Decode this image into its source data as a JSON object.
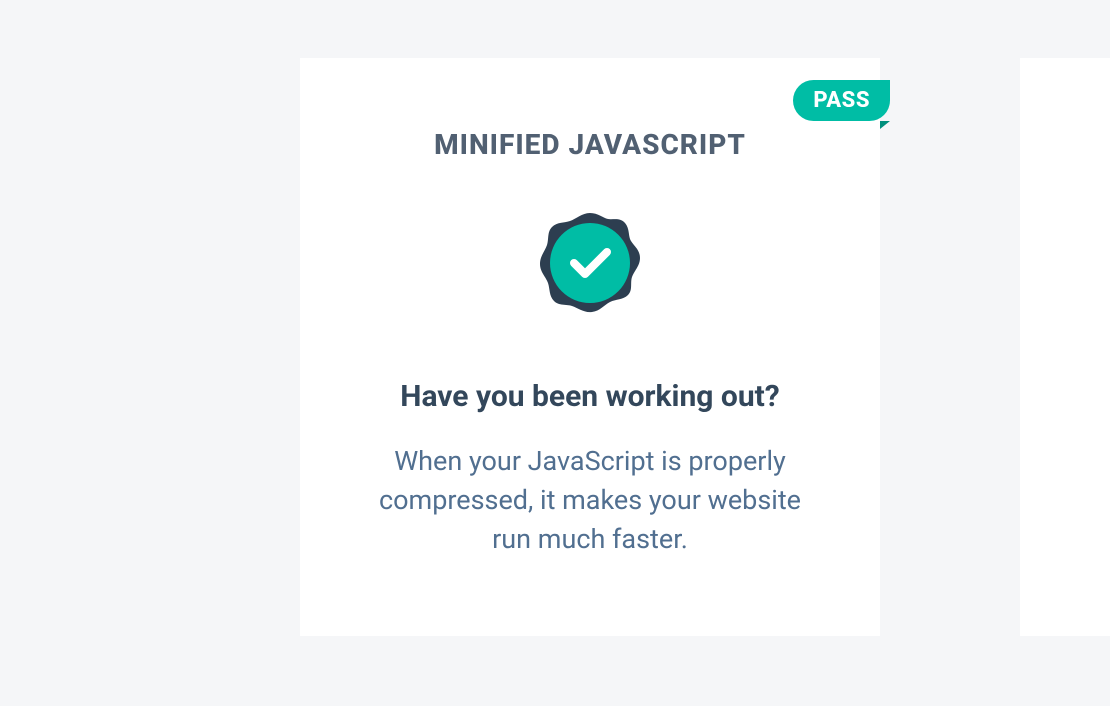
{
  "card1": {
    "status": "PASS",
    "title": "MINIFIED JAVASCRIPT",
    "heading": "Have you been working out?",
    "description": "When your JavaScript is properly compressed, it makes your website run much faster.",
    "status_color": "#00bda5",
    "badge_color": "#00bda5",
    "badge_outline": "#2d3e50"
  }
}
